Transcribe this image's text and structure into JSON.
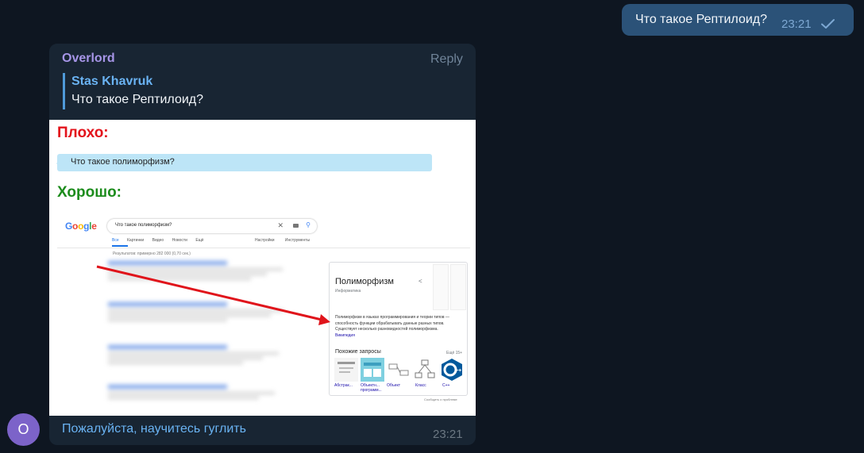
{
  "outgoing": {
    "text": "Что такое Рептилоид?",
    "time": "23:21",
    "status_icon": "check-icon"
  },
  "incoming": {
    "sender": "Overlord",
    "reply_label": "Reply",
    "quote": {
      "name": "Stas Khavruk",
      "text": "Что такое Рептилоид?"
    },
    "caption": "Пожалуйста, научитесь гуглить",
    "time": "23:21",
    "avatar_letter": "O"
  },
  "image": {
    "bad_label": "Плохо:",
    "bubble_text": "Что такое полиморфизм?",
    "good_label": "Хорошо:",
    "google": {
      "logo": "Google",
      "query": "Что такое полиморфизм?",
      "tabs": [
        "Все",
        "Картинки",
        "Видео",
        "Новости",
        "Ещё"
      ],
      "tabs_right": [
        "Настройки",
        "Инструменты"
      ],
      "result_count": "Результатов: примерно 282 000 (0,70 сек.)",
      "panel": {
        "title": "Полиморфизм",
        "subtitle": "Информатика",
        "description": "Полиморфизм в языках программирования и теории типов — способность функции обрабатывать данные разных типов. Существует несколько разновидностей полиморфизма.",
        "source": "Википедия",
        "related_title": "Похожие запросы",
        "related_more": "Ещё 15+",
        "related": [
          "Абстрак...",
          "Объектн... программ...",
          "Объект",
          "Класс",
          "C++"
        ]
      },
      "report": "Сообщить о проблеме"
    }
  },
  "colors": {
    "background": "#0e1621",
    "outgoing_bubble": "#2b5278",
    "incoming_bubble": "#182533",
    "accent": "#6ab3f3",
    "sender": "#a695e7",
    "bad": "#e3131b",
    "good": "#1c8c1c",
    "arrow": "#e0141b"
  }
}
